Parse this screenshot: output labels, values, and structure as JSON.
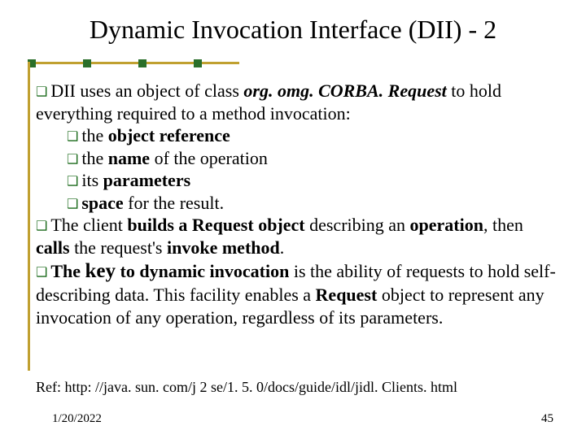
{
  "title": "Dynamic Invocation Interface (DII) - 2",
  "p1a": "DII uses an object of class ",
  "p1b": "org. omg. CORBA. Request",
  "p1c": " to hold everything required to a method invocation:",
  "s1a": "the ",
  "s1b": "object reference",
  "s2a": "the ",
  "s2b": "name",
  "s2c": " of the operation",
  "s3a": "its ",
  "s3b": "parameters",
  "s4a": "space",
  "s4b": " for the result.",
  "p2a": "The client ",
  "p2b": "builds a Request object",
  "p2c": " describing an ",
  "p2d": "operation",
  "p2e": ", then ",
  "p2f": "calls",
  "p2g": " the request's ",
  "p2h": "invoke method",
  "p2i": ".",
  "p3a": "The ",
  "p3b": "key",
  "p3c": " to dynamic invocation",
  "p3d": " is the ability of requests to hold self-describing data. This facility enables a ",
  "p3e": "Request",
  "p3f": " object to represent any invocation of any operation, regardless of its parameters.",
  "ref": "Ref: http: //java. sun. com/j 2 se/1. 5. 0/docs/guide/idl/jidl. Clients. html",
  "date": "1/20/2022",
  "page": "45",
  "bullet": "❑"
}
